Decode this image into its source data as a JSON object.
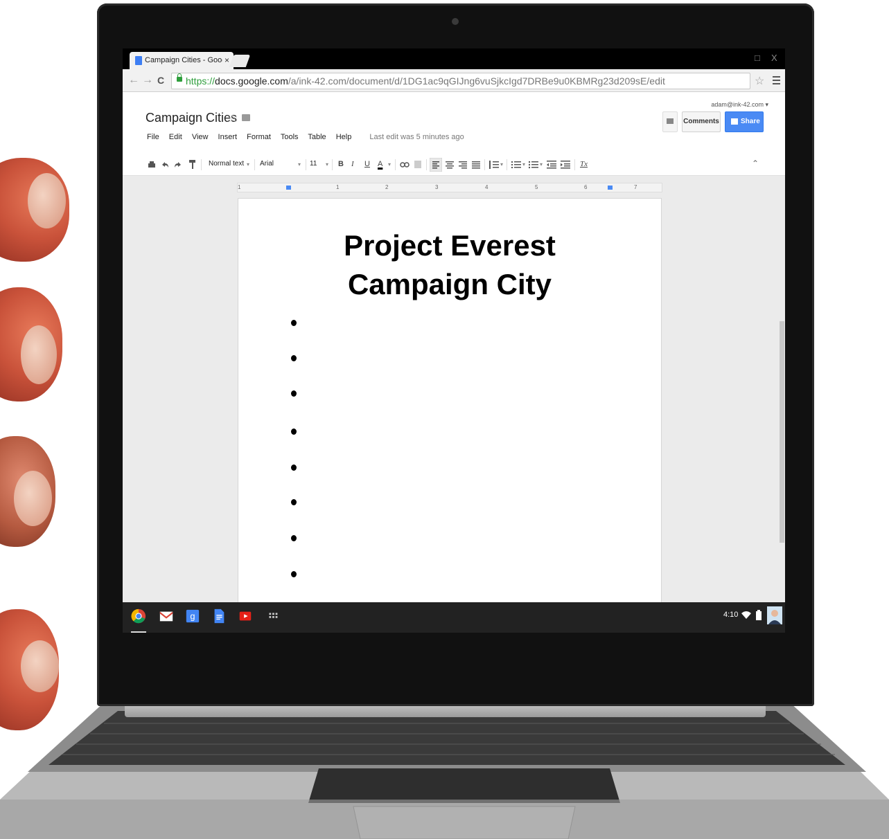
{
  "browser": {
    "tab_title": "Campaign Cities - Googl",
    "tab_close": "×",
    "window_controls": [
      "□",
      "X"
    ],
    "nav": {
      "back": "←",
      "forward": "→",
      "reload": "C"
    },
    "url_scheme": "https://",
    "url_host": "docs.google.com",
    "url_path": "/a/ink-42.com/document/d/1DG1ac9qGIJng6vuSjkcIgd7DRBe9u0KBMRg23d209sE/edit",
    "star": "☆"
  },
  "docs": {
    "title": "Campaign Cities",
    "title_star": "☆",
    "account": "adam@ink-42.com ▾",
    "menu": [
      "File",
      "Edit",
      "View",
      "Insert",
      "Format",
      "Tools",
      "Table",
      "Help"
    ],
    "last_edit": "Last edit was 5 minutes ago",
    "comments_label": "Comments",
    "share_label": "Share"
  },
  "toolbar": {
    "style": "Normal text",
    "font": "Arial",
    "size": "11",
    "bold": "B",
    "italic": "I",
    "underline": "U",
    "text_color": "A",
    "clear_format": "Tx",
    "collapse": "⌃"
  },
  "ruler": {
    "numbers": [
      "1",
      "1",
      "2",
      "3",
      "4",
      "5",
      "6",
      "7"
    ]
  },
  "document": {
    "heading_line1": "Project Everest",
    "heading_line2": "Campaign City",
    "bullet_count": 8
  },
  "shelf": {
    "time": "4:10",
    "apps": [
      "chrome-icon",
      "gmail-icon",
      "google-search-icon",
      "docs-icon",
      "youtube-icon",
      "app-launcher-icon"
    ]
  },
  "colors": {
    "accent": "#4a8af4",
    "secure": "#2e9e3c"
  }
}
